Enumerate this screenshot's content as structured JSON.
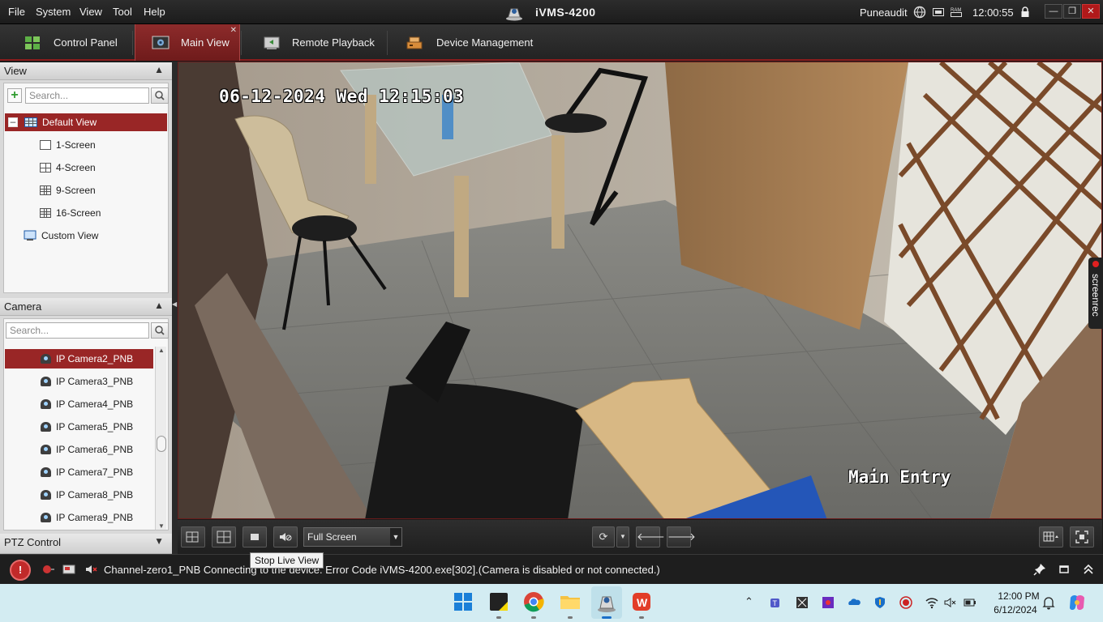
{
  "menu": [
    "File",
    "System",
    "View",
    "Tool",
    "Help"
  ],
  "app_title": "iVMS-4200",
  "user": "Puneaudit",
  "clock": "12:00:55",
  "tabs": [
    {
      "label": "Control Panel"
    },
    {
      "label": "Main View",
      "active": true
    },
    {
      "label": "Remote Playback"
    },
    {
      "label": "Device Management"
    }
  ],
  "view_panel": {
    "title": "View",
    "search_placeholder": "Search...",
    "items": [
      {
        "label": "Default View",
        "selected": true
      },
      {
        "label": "1-Screen"
      },
      {
        "label": "4-Screen"
      },
      {
        "label": "9-Screen"
      },
      {
        "label": "16-Screen"
      },
      {
        "label": "Custom View"
      }
    ]
  },
  "camera_panel": {
    "title": "Camera",
    "search_placeholder": "Search...",
    "items": [
      {
        "label": "IP Camera2_PNB",
        "selected": true
      },
      {
        "label": "IP Camera3_PNB"
      },
      {
        "label": "IP Camera4_PNB"
      },
      {
        "label": "IP Camera5_PNB"
      },
      {
        "label": "IP Camera6_PNB"
      },
      {
        "label": "IP Camera7_PNB"
      },
      {
        "label": "IP Camera8_PNB"
      },
      {
        "label": "IP Camera9_PNB"
      }
    ]
  },
  "ptz_panel": {
    "title": "PTZ Control"
  },
  "video": {
    "osd_time": "06-12-2024 Wed 12:15:03",
    "osd_name": "Main Entry"
  },
  "screenrec_label": "screenrec",
  "toolbar": {
    "screen_mode": "Full Screen",
    "tooltip": "Stop Live View"
  },
  "status": {
    "message": "Channel-zero1_PNB Connecting to the device. Error Code iVMS-4200.exe[302].(Camera is disabled or not connected.)"
  },
  "taskbar": {
    "time": "12:00 PM",
    "date": "6/12/2024"
  },
  "colors": {
    "accent": "#992626",
    "tab_active": "#8d2b2b",
    "panel_bg": "#d9d9d9",
    "taskbar_bg": "#d3ecf2"
  }
}
